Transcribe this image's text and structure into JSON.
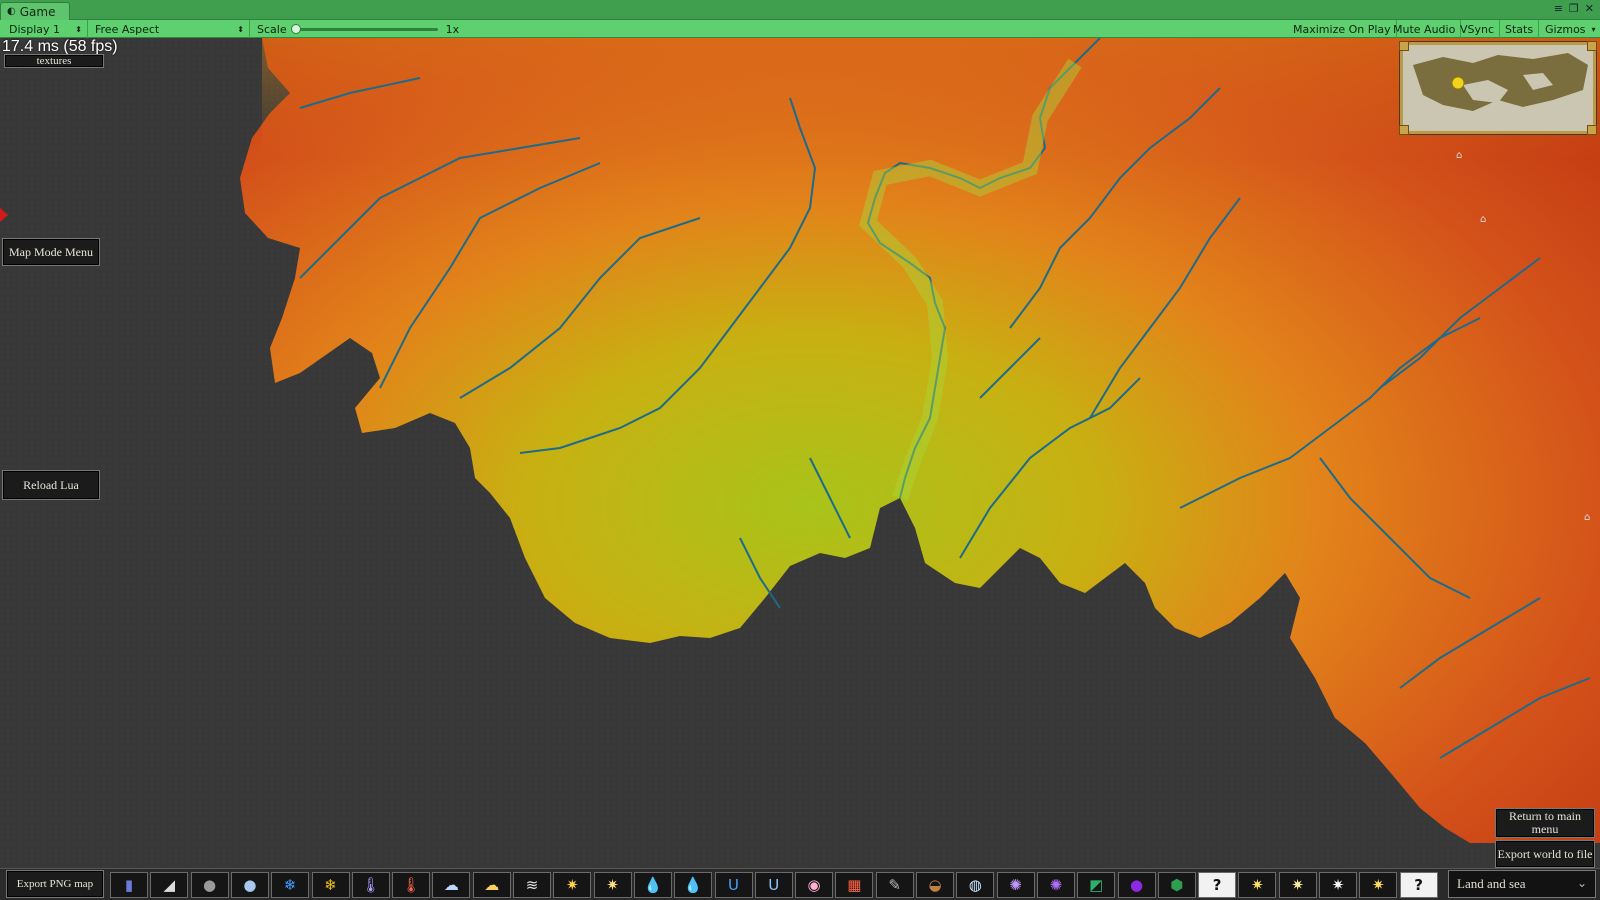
{
  "editor": {
    "tab_label": "Game",
    "display": "Display 1",
    "aspect": "Free Aspect",
    "scale_label": "Scale",
    "scale_value": "1x",
    "maximize_on_play": "Maximize On Play",
    "mute_audio": "Mute Audio",
    "vsync": "VSync",
    "stats": "Stats",
    "gizmos": "Gizmos"
  },
  "overlay": {
    "fps_text": "17.4 ms (58 fps)",
    "textures_button": "textures",
    "map_mode_menu": "Map Mode Menu",
    "reload_lua": "Reload Lua",
    "export_png_map": "Export PNG map",
    "return_to_main_menu": "Return to main menu",
    "export_world_to_file": "Export world to file",
    "map_mode_selected": "Land and sea"
  },
  "map_mode_buttons": [
    {
      "icon": "population-icon",
      "glyph": "▮"
    },
    {
      "icon": "rock-icon",
      "glyph": "◢"
    },
    {
      "icon": "globe-dark-icon",
      "glyph": "●"
    },
    {
      "icon": "globe-light-icon",
      "glyph": "●"
    },
    {
      "icon": "snowflake-blue-icon",
      "glyph": "❄"
    },
    {
      "icon": "snowflake-yellow-icon",
      "glyph": "❄"
    },
    {
      "icon": "thermometer-cold-icon",
      "glyph": "🌡"
    },
    {
      "icon": "thermometer-hot-icon",
      "glyph": "🌡"
    },
    {
      "icon": "cloud-snow-icon",
      "glyph": "☁"
    },
    {
      "icon": "cloud-sun-icon",
      "glyph": "☁"
    },
    {
      "icon": "wind-icon",
      "glyph": "≋"
    },
    {
      "icon": "sun-icon",
      "glyph": "✷"
    },
    {
      "icon": "sun-alt-icon",
      "glyph": "✷"
    },
    {
      "icon": "water-drop-icon",
      "glyph": "💧"
    },
    {
      "icon": "water-drop-multi-icon",
      "glyph": "💧"
    },
    {
      "icon": "magnet-icon",
      "glyph": "U"
    },
    {
      "icon": "magnet-alt-icon",
      "glyph": "U"
    },
    {
      "icon": "biome-icon",
      "glyph": "◉"
    },
    {
      "icon": "tiles-icon",
      "glyph": "▦"
    },
    {
      "icon": "feather-icon",
      "glyph": "✎"
    },
    {
      "icon": "pot-icon",
      "glyph": "◒"
    },
    {
      "icon": "bubble-icon",
      "glyph": "◍"
    },
    {
      "icon": "bug-icon",
      "glyph": "✺"
    },
    {
      "icon": "bug-purple-icon",
      "glyph": "✺"
    },
    {
      "icon": "terrain-slope-icon",
      "glyph": "◩"
    },
    {
      "icon": "purple-orb-icon",
      "glyph": "●"
    },
    {
      "icon": "green-hex-icon",
      "glyph": "⬢"
    },
    {
      "icon": "question-icon",
      "glyph": "?"
    },
    {
      "icon": "star-icon",
      "glyph": "✷"
    },
    {
      "icon": "star-alt-icon",
      "glyph": "✷"
    },
    {
      "icon": "star-white-icon",
      "glyph": "✷"
    },
    {
      "icon": "star-yellow-icon",
      "glyph": "✷"
    },
    {
      "icon": "question-alt-icon",
      "glyph": "?"
    }
  ],
  "colors": {
    "sea": "#3a3a3a",
    "land_low": "#c93b10",
    "land_mid": "#e0701a",
    "land_high": "#b4c21a",
    "river": "#1b6b86"
  }
}
